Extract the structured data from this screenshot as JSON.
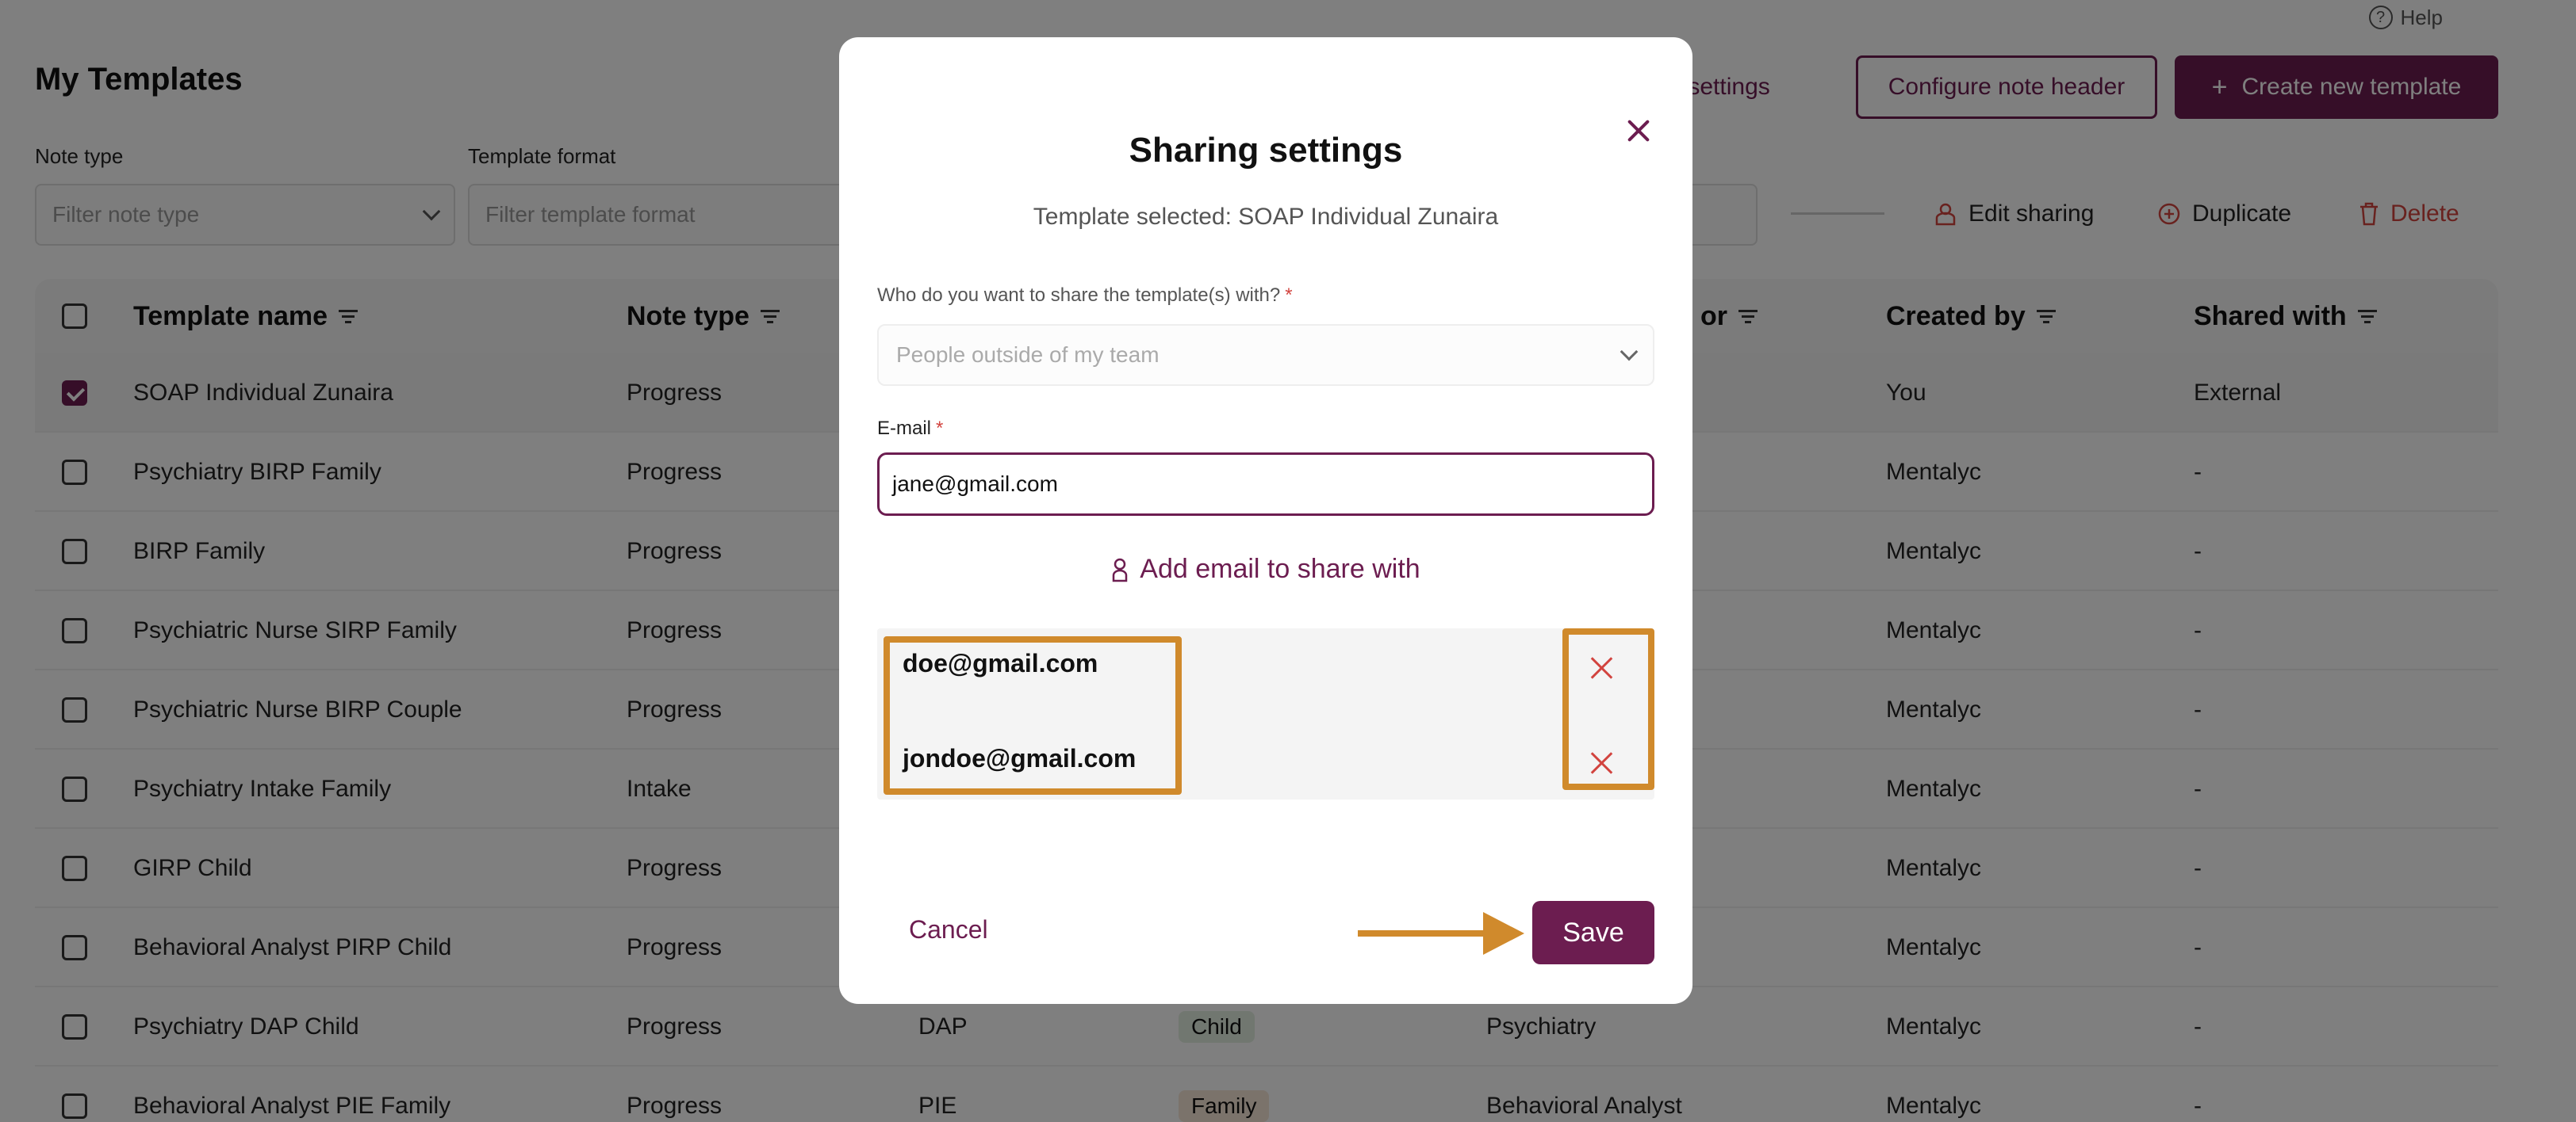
{
  "help": {
    "label": "Help",
    "icon": "question-circle-icon"
  },
  "page_title": "My Templates",
  "top_actions": {
    "global_settings": "bal settings",
    "configure_header": "Configure note header",
    "create_template": "Create new template"
  },
  "filters": {
    "note_type_label": "Note type",
    "note_type_placeholder": "Filter note type",
    "template_format_label": "Template format",
    "template_format_placeholder": "Filter template format"
  },
  "bulk_actions": {
    "edit_sharing": "Edit sharing",
    "duplicate": "Duplicate",
    "delete": "Delete"
  },
  "table": {
    "headers": {
      "template_name": "Template name",
      "note_type": "Note type",
      "author_partial": "or",
      "created_by": "Created by",
      "shared_with": "Shared with"
    },
    "rows": [
      {
        "checked": true,
        "name": "SOAP Individual Zunaira",
        "note_type": "Progress",
        "format": "",
        "tag": "",
        "tag_color": "",
        "author": "",
        "created_by": "You",
        "shared_with": "External"
      },
      {
        "checked": false,
        "name": "Psychiatry BIRP Family",
        "note_type": "Progress",
        "format": "",
        "tag": "",
        "tag_color": "",
        "author": "",
        "created_by": "Mentalyc",
        "shared_with": "-"
      },
      {
        "checked": false,
        "name": "BIRP Family",
        "note_type": "Progress",
        "format": "",
        "tag": "",
        "tag_color": "",
        "author": "",
        "created_by": "Mentalyc",
        "shared_with": "-"
      },
      {
        "checked": false,
        "name": "Psychiatric Nurse SIRP Family",
        "note_type": "Progress",
        "format": "",
        "tag": "",
        "tag_color": "",
        "author": "",
        "created_by": "Mentalyc",
        "shared_with": "-"
      },
      {
        "checked": false,
        "name": "Psychiatric Nurse BIRP Couple",
        "note_type": "Progress",
        "format": "",
        "tag": "",
        "tag_color": "",
        "author": "",
        "created_by": "Mentalyc",
        "shared_with": "-"
      },
      {
        "checked": false,
        "name": "Psychiatry Intake Family",
        "note_type": "Intake",
        "format": "",
        "tag": "",
        "tag_color": "",
        "author": "",
        "created_by": "Mentalyc",
        "shared_with": "-"
      },
      {
        "checked": false,
        "name": "GIRP Child",
        "note_type": "Progress",
        "format": "",
        "tag": "",
        "tag_color": "",
        "author": "",
        "created_by": "Mentalyc",
        "shared_with": "-"
      },
      {
        "checked": false,
        "name": "Behavioral Analyst PIRP Child",
        "note_type": "Progress",
        "format": "",
        "tag": "",
        "tag_color": "",
        "author": "",
        "created_by": "Mentalyc",
        "shared_with": "-"
      },
      {
        "checked": false,
        "name": "Psychiatry DAP Child",
        "note_type": "Progress",
        "format": "DAP",
        "tag": "Child",
        "tag_color": "#e3efe1",
        "author": "Psychiatry",
        "created_by": "Mentalyc",
        "shared_with": "-"
      },
      {
        "checked": false,
        "name": "Behavioral Analyst PIE Family",
        "note_type": "Progress",
        "format": "PIE",
        "tag": "Family",
        "tag_color": "#f7e6d6",
        "author": "Behavioral Analyst",
        "created_by": "Mentalyc",
        "shared_with": "-"
      }
    ]
  },
  "modal": {
    "title": "Sharing settings",
    "subtitle": "Template selected: SOAP Individual Zunaira",
    "share_with_label": "Who do you want to share the template(s) with?",
    "share_with_placeholder": "People outside of my team",
    "email_label": "E-mail",
    "required_mark": "*",
    "email_value": "jane@gmail.com",
    "add_email": "Add email to share with",
    "shared_emails": [
      "doe@gmail.com",
      "jondoe@gmail.com"
    ],
    "cancel": "Cancel",
    "save": "Save"
  },
  "colors": {
    "brand": "#6c1d50",
    "danger": "#d2443f",
    "highlight": "#d08a2c"
  }
}
